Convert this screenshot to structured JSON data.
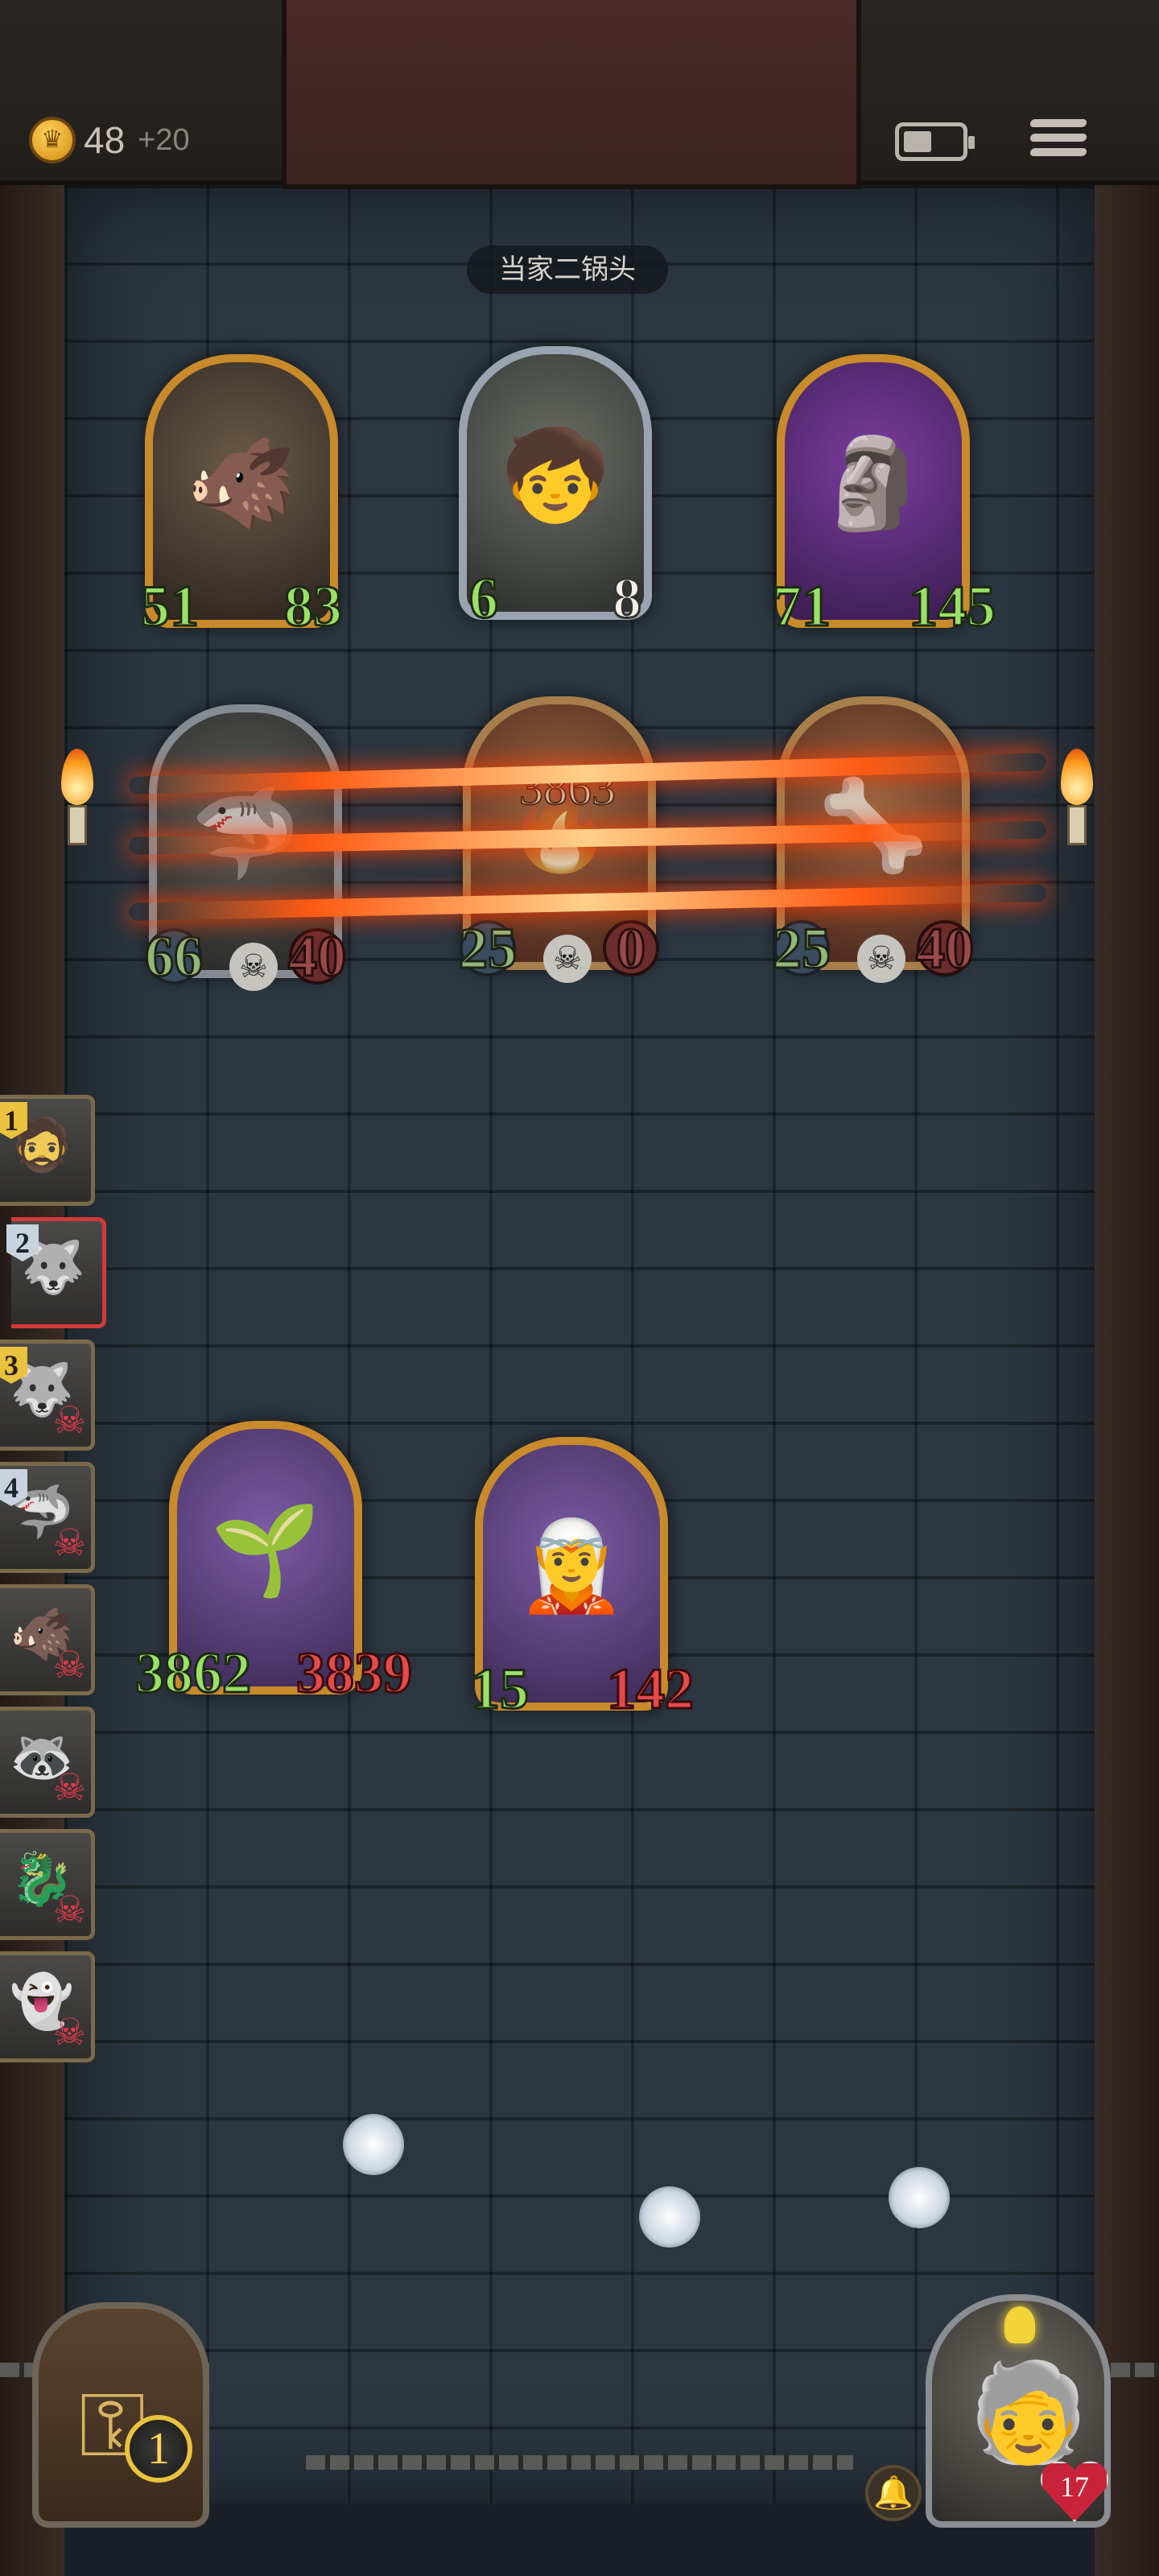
{
  "header": {
    "gold": "48",
    "gold_bonus": "+20",
    "coin_icon": "crown-coin-icon",
    "battery_icon": "battery-icon",
    "menu_icon": "menu-icon"
  },
  "boss_label": "当家二锅头",
  "enemy_row_1": [
    {
      "name": "boar-brute",
      "attack": "51",
      "health": "83",
      "frame": "gold",
      "icon": "🐗"
    },
    {
      "name": "spear-boy",
      "attack": "6",
      "health": "8",
      "frame": "silver",
      "icon": "🧒"
    },
    {
      "name": "tiki-totem",
      "attack": "71",
      "health": "145",
      "frame": "purple",
      "icon": "🗿"
    }
  ],
  "enemy_row_2": [
    {
      "name": "dead-shark",
      "attack": "66",
      "health": "40",
      "dead": true,
      "icon": "🦈"
    },
    {
      "name": "fire-golem",
      "attack": "25",
      "health": "0",
      "damage": "3863",
      "dead": true,
      "icon": "🔥"
    },
    {
      "name": "bone-beast",
      "attack": "25",
      "health": "40",
      "dead": true,
      "icon": "🦴"
    }
  ],
  "turn_order": [
    {
      "badge": "1",
      "icon": "🧔",
      "dead": false,
      "badge_style": "gold"
    },
    {
      "badge": "2",
      "icon": "🐺",
      "dead": false,
      "badge_style": "silver",
      "active": true
    },
    {
      "badge": "3",
      "icon": "🐺",
      "dead": true,
      "badge_style": "gold"
    },
    {
      "badge": "4",
      "icon": "🦈",
      "dead": true,
      "badge_style": "silver"
    },
    {
      "badge": "",
      "icon": "🐗",
      "dead": true
    },
    {
      "badge": "",
      "icon": "🦝",
      "dead": true
    },
    {
      "badge": "",
      "icon": "🐉",
      "dead": true
    },
    {
      "badge": "",
      "icon": "👻",
      "dead": true
    }
  ],
  "allies": [
    {
      "name": "sprout-girl",
      "attack": "3862",
      "health": "3839",
      "icon": "🌱"
    },
    {
      "name": "elf-sorceress",
      "attack": "15",
      "health": "142",
      "icon": "🧝"
    }
  ],
  "bottom": {
    "deck_count": "1",
    "hero_hp": "17",
    "deck_icon": "key-icon",
    "bell_icon": "bell-icon"
  }
}
